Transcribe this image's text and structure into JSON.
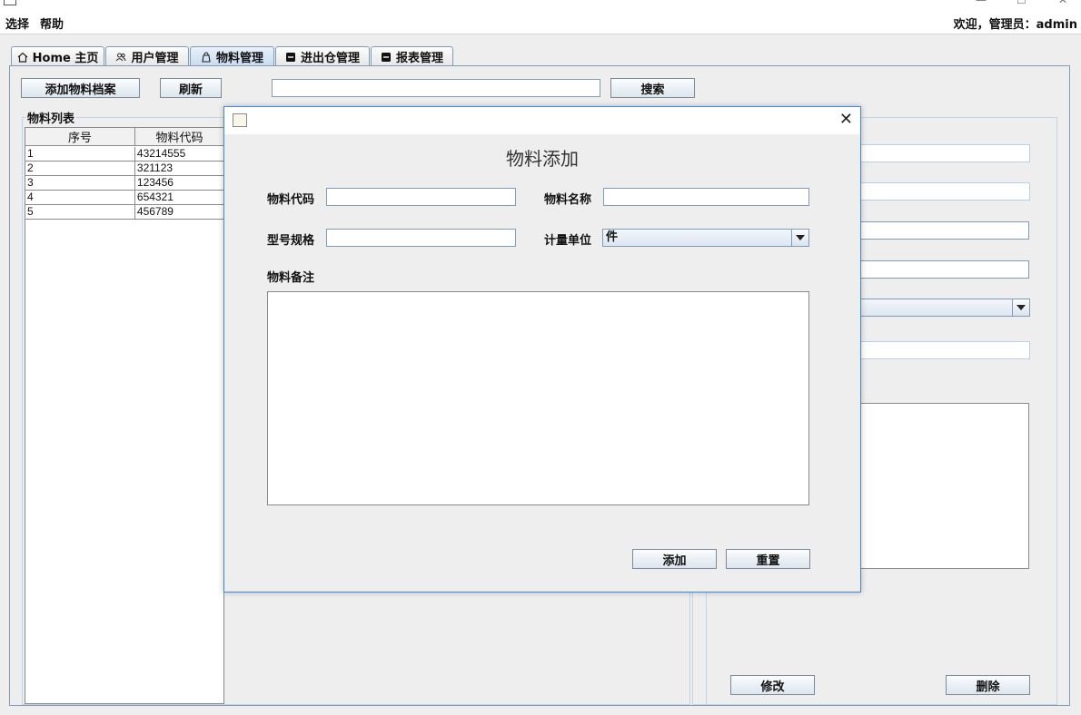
{
  "menu": {
    "items": [
      "选择",
      "帮助"
    ],
    "welcome": "欢迎，管理员：admin"
  },
  "window": {
    "minimize": "—",
    "maximize": "☐",
    "close": "✕"
  },
  "tabs": [
    {
      "label": "Home 主页",
      "icon": "home-icon"
    },
    {
      "label": "用户管理",
      "icon": "users-icon"
    },
    {
      "label": "物料管理",
      "icon": "bag-icon",
      "active": true
    },
    {
      "label": "进出仓管理",
      "icon": "box-icon"
    },
    {
      "label": "报表管理",
      "icon": "box-icon"
    }
  ],
  "toolbar": {
    "add_label": "添加物料档案",
    "refresh_label": "刷新",
    "search_value": "",
    "search_label": "搜索"
  },
  "list": {
    "title": "物料列表",
    "columns": [
      "序号",
      "物料代码"
    ],
    "rows": [
      [
        "1",
        "43214555"
      ],
      [
        "2",
        "321123"
      ],
      [
        "3",
        "123456"
      ],
      [
        "4",
        "654321"
      ],
      [
        "5",
        "456789"
      ]
    ]
  },
  "detail": {
    "modify_label": "修改",
    "delete_label": "删除"
  },
  "dialog": {
    "heading": "物料添加",
    "code_label": "物料代码",
    "code_value": "",
    "name_label": "物料名称",
    "name_value": "",
    "spec_label": "型号规格",
    "spec_value": "",
    "unit_label": "计量单位",
    "unit_value": "件",
    "remark_label": "物料备注",
    "remark_value": "",
    "add_label": "添加",
    "reset_label": "重置",
    "close": "✕"
  }
}
